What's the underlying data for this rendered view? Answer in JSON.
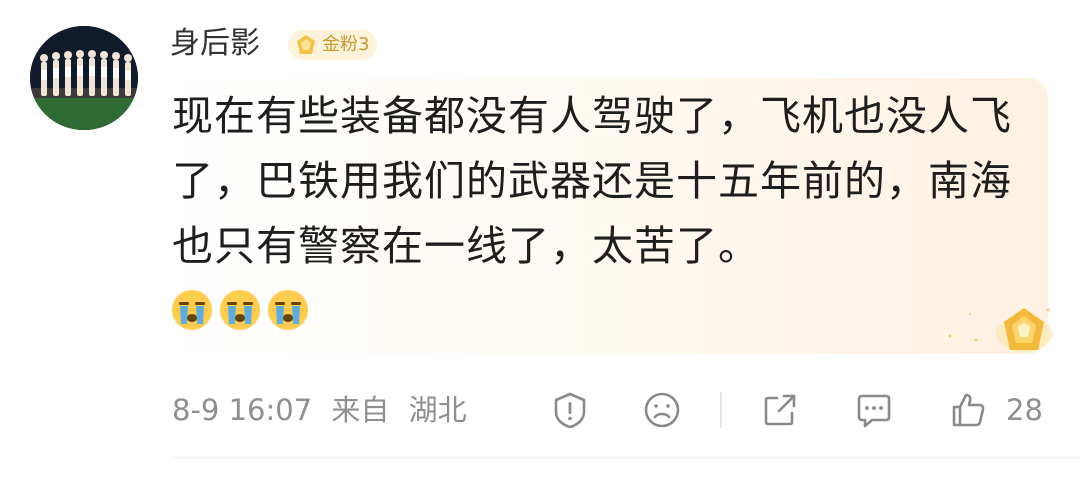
{
  "comment": {
    "username": "身后影",
    "badge_label": "金粉3",
    "text": "现在有些装备都没有人驾驶了，飞机也没人飞了，巴铁用我们的武器还是十五年前的，南海也只有警察在一线了，太苦了。",
    "emojis": [
      "crying-face-icon",
      "crying-face-icon",
      "crying-face-icon"
    ]
  },
  "meta": {
    "time": "8-9 16:07",
    "source_prefix": "来自",
    "location": "湖北"
  },
  "actions": {
    "like_count": "28",
    "icons": [
      "report-icon",
      "dislike-face-icon",
      "share-icon",
      "reply-icon",
      "thumbs-up-icon"
    ]
  },
  "colors": {
    "badge_bg": "#fdf3da",
    "badge_text": "#c99a2e",
    "meta_text": "#8f8f8f",
    "bubble_gradient_end": "#fff1e2"
  }
}
